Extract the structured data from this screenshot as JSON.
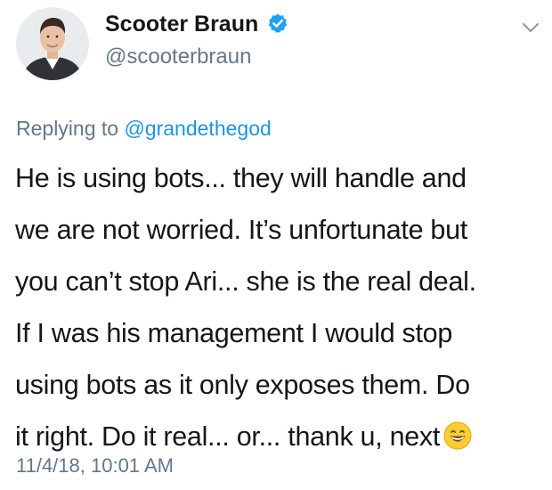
{
  "author": {
    "name": "Scooter Braun",
    "handle": "@scooterbraun",
    "verified": true,
    "avatar_icon": "avatar-photo"
  },
  "reply": {
    "prefix": "Replying to",
    "mention": "@grandethegod"
  },
  "tweet": {
    "lines": [
      "He is using bots... they will handle and",
      "we are not worried. It’s unfortunate but",
      "you can’t stop Ari... she is the real deal.",
      "If I was his management I would stop",
      "using bots as it only exposes them. Do",
      "it right. Do it real... or... thank u, next"
    ],
    "trailing_emoji": "grinning-face-emoji"
  },
  "timestamp": "11/4/18, 10:01 AM",
  "colors": {
    "text": "#14171a",
    "secondary": "#657786",
    "link": "#1b95e0",
    "verified": "#1da1f2"
  }
}
